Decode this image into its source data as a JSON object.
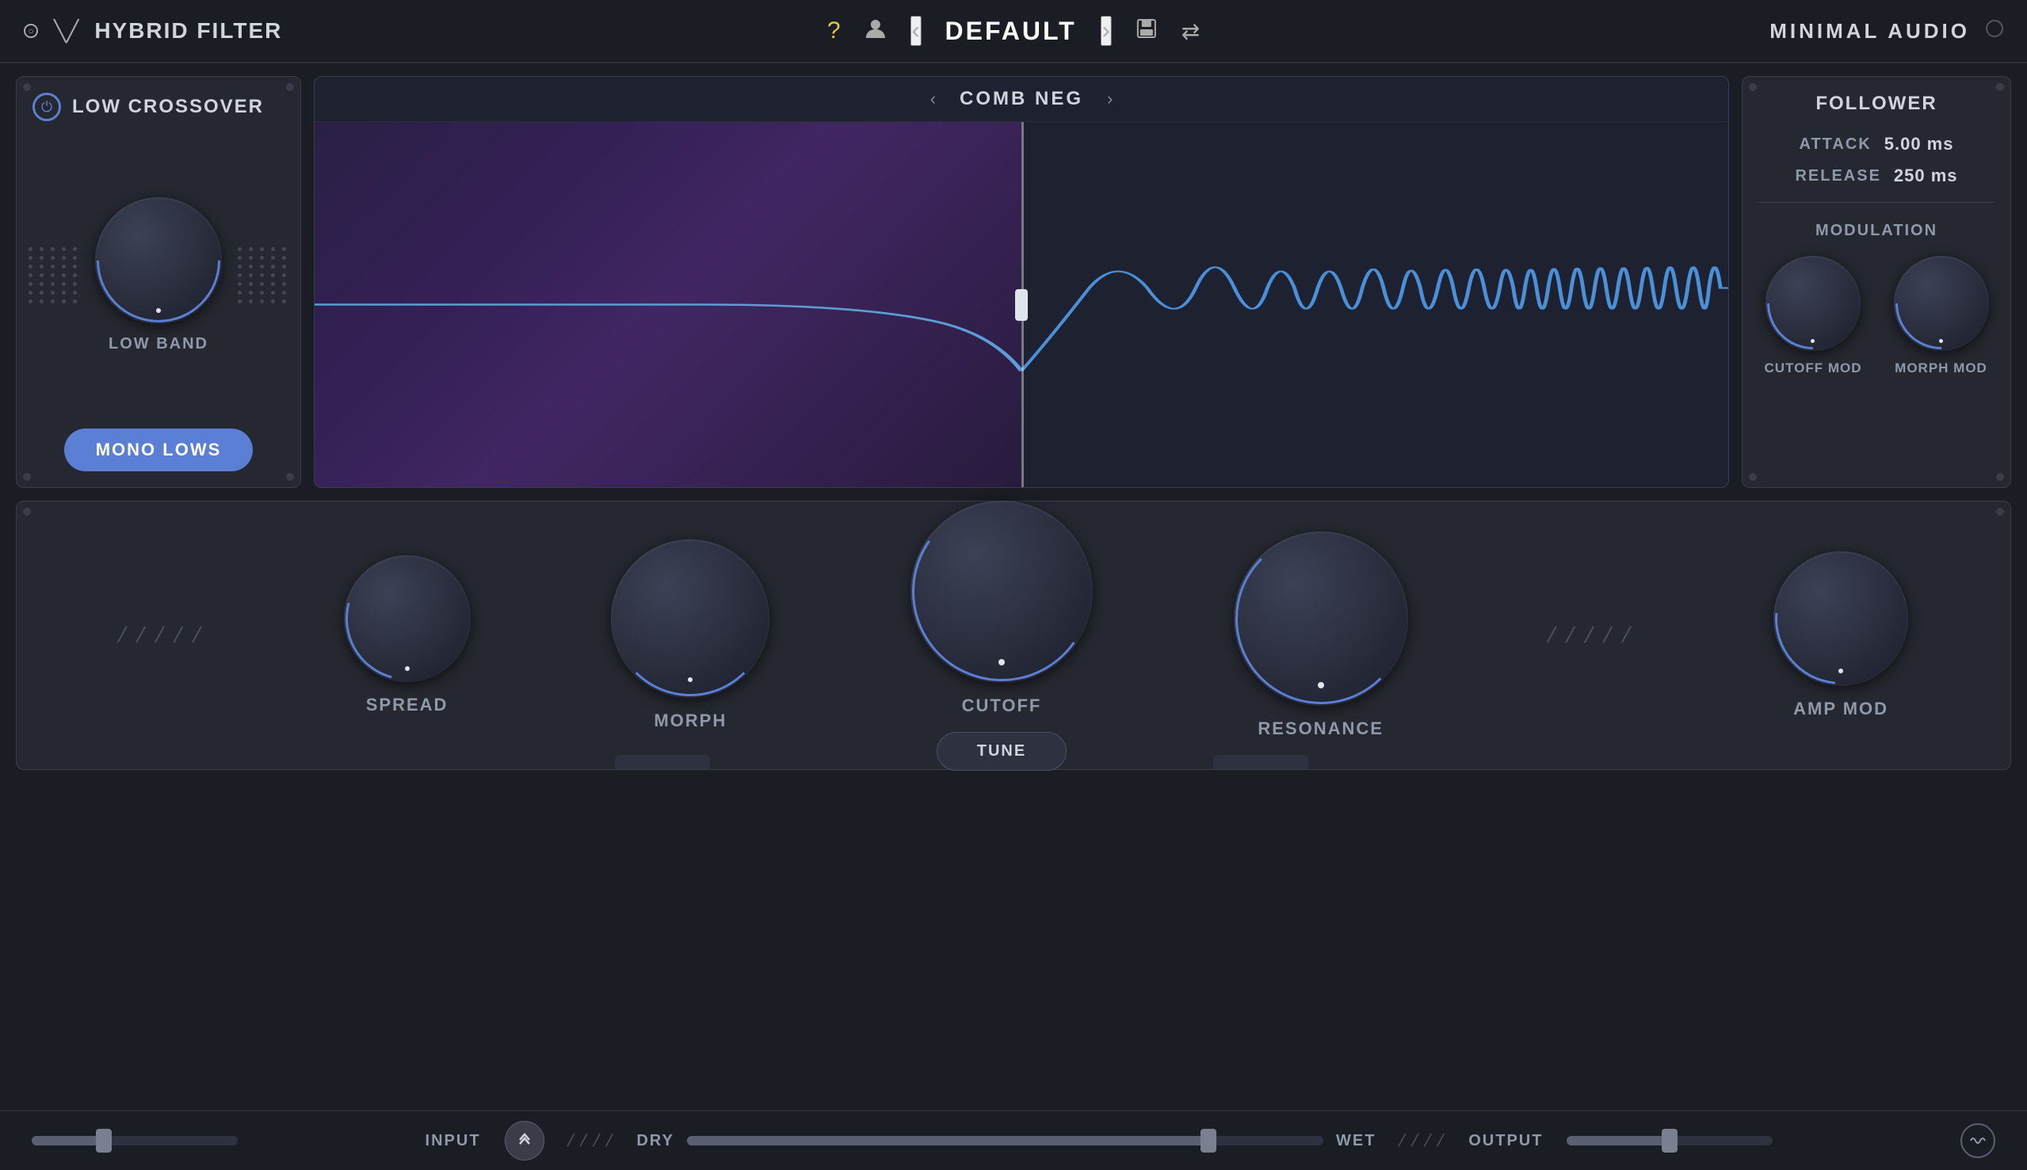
{
  "app": {
    "plugin_name": "HYBRID FILTER",
    "brand": "MINIMAL AUDIO",
    "preset": "DEFAULT"
  },
  "header": {
    "help_icon": "?",
    "user_icon": "👤",
    "prev_label": "‹",
    "next_label": "›",
    "save_icon": "💾",
    "shuffle_icon": "⇌"
  },
  "low_crossover": {
    "title": "LOW CROSSOVER",
    "knob_label": "LOW BAND",
    "mono_lows_label": "MONO LOWS",
    "power_symbol": "⏻"
  },
  "filter_display": {
    "title": "COMB NEG",
    "prev_label": "‹",
    "next_label": "›"
  },
  "follower": {
    "title": "FOLLOWER",
    "attack_label": "ATTACK",
    "attack_value": "5.00 ms",
    "release_label": "RELEASE",
    "release_value": "250 ms",
    "modulation_title": "MODULATION",
    "cutoff_mod_label": "CUTOFF MOD",
    "morph_mod_label": "MORPH MOD"
  },
  "bottom_controls": {
    "spread_label": "SPREAD",
    "morph_label": "MORPH",
    "cutoff_label": "CUTOFF",
    "resonance_label": "RESONANCE",
    "amp_mod_label": "AMP MOD",
    "tune_label": "TUNE"
  },
  "bottom_bar": {
    "input_label": "INPUT",
    "dry_label": "DRY",
    "wet_label": "WET",
    "output_label": "OUTPUT",
    "input_fill_pct": 35,
    "input_thumb_pct": 35,
    "dry_wet_thumb_pct": 82,
    "output_fill_pct": 50,
    "output_thumb_pct": 50
  },
  "colors": {
    "accent_blue": "#5a7fd4",
    "bg_dark": "#1a1d24",
    "panel_bg": "#252830",
    "text_primary": "#d0d4dc",
    "text_secondary": "#9099a8",
    "border": "#3a3d48",
    "filter_line": "#4a90d9",
    "purple_bg": "#3a2060"
  }
}
